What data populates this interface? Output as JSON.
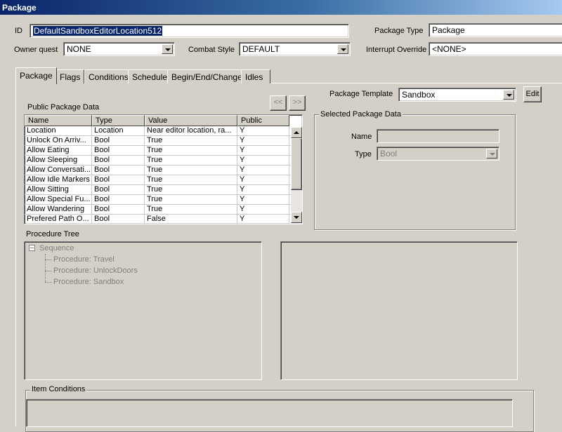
{
  "window": {
    "title": "Package"
  },
  "id_field": {
    "label": "ID",
    "value": "DefaultSandboxEditorLocation512"
  },
  "package_type": {
    "label": "Package Type",
    "value": "Package"
  },
  "owner_quest": {
    "label": "Owner quest",
    "value": "NONE"
  },
  "combat_style": {
    "label": "Combat Style",
    "value": "DEFAULT"
  },
  "interrupt_override": {
    "label": "Interrupt Override",
    "value": "<NONE>"
  },
  "tabs": [
    {
      "label": "Package"
    },
    {
      "label": "Flags"
    },
    {
      "label": "Conditions"
    },
    {
      "label": "Schedule"
    },
    {
      "label": "Begin/End/Change"
    },
    {
      "label": "Idles"
    }
  ],
  "package_template": {
    "label": "Package Template",
    "value": "Sandbox",
    "edit_label": "Edit"
  },
  "public_data": {
    "label": "Public Package Data",
    "nav_prev": "<<",
    "nav_next": ">>",
    "columns": [
      "Name",
      "Type",
      "Value",
      "Public"
    ],
    "rows": [
      [
        "Location",
        "Location",
        "Near editor location, ra...",
        "Y"
      ],
      [
        "Unlock On Arriv...",
        "Bool",
        "True",
        "Y"
      ],
      [
        "Allow Eating",
        "Bool",
        "True",
        "Y"
      ],
      [
        "Allow Sleeping",
        "Bool",
        "True",
        "Y"
      ],
      [
        "Allow Conversati...",
        "Bool",
        "True",
        "Y"
      ],
      [
        "Allow Idle Markers",
        "Bool",
        "True",
        "Y"
      ],
      [
        "Allow Sitting",
        "Bool",
        "True",
        "Y"
      ],
      [
        "Allow Special Fu...",
        "Bool",
        "True",
        "Y"
      ],
      [
        "Allow Wandering",
        "Bool",
        "True",
        "Y"
      ],
      [
        "Prefered Path O...",
        "Bool",
        "False",
        "Y"
      ]
    ]
  },
  "selected_data": {
    "label": "Selected Package Data",
    "name_label": "Name",
    "name_value": "",
    "type_label": "Type",
    "type_value": "Bool"
  },
  "procedure_tree": {
    "label": "Procedure Tree",
    "root": "Sequence",
    "expander": "−",
    "children": [
      "Procedure: Travel",
      "Procedure: UnlockDoors",
      "Procedure: Sandbox"
    ]
  },
  "item_conditions": {
    "label": "Item Conditions"
  },
  "colors": {
    "face": "#d4d0c8",
    "selection": "#0a246a",
    "title_start": "#0a246a",
    "title_end": "#a6caf0",
    "disabled_text": "#808080"
  }
}
